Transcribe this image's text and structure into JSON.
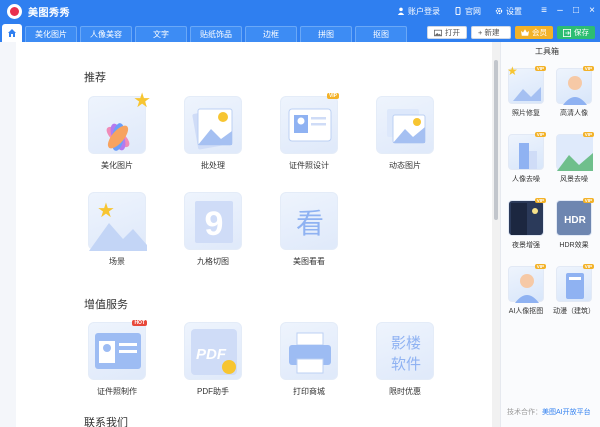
{
  "app": {
    "title": "美图秀秀"
  },
  "titlebar": {
    "account_label": "账户登录",
    "website_label": "官网",
    "settings_label": "设置"
  },
  "nav": {
    "tabs": [
      "美化图片",
      "人像美容",
      "文字",
      "贴纸饰品",
      "边框",
      "拼图",
      "抠图"
    ],
    "open_label": "打开",
    "new_label": "+ 新建",
    "vip_label": "会员",
    "save_label": "保存"
  },
  "sections": {
    "recommend": "推荐",
    "value_added": "增值服务",
    "contact": "联系我们"
  },
  "recommend_items": [
    {
      "label": "美化图片",
      "badge": ""
    },
    {
      "label": "批处理",
      "badge": ""
    },
    {
      "label": "证件照设计",
      "badge": "VIP"
    },
    {
      "label": "动态图片",
      "badge": ""
    },
    {
      "label": "场景",
      "badge": ""
    },
    {
      "label": "九格切图",
      "badge": ""
    },
    {
      "label": "美图看看",
      "badge": ""
    }
  ],
  "value_items": [
    {
      "label": "证件照制作",
      "badge": "HOT"
    },
    {
      "label": "PDF助手",
      "badge": ""
    },
    {
      "label": "打印商城",
      "badge": ""
    },
    {
      "label": "限时优惠",
      "badge": ""
    }
  ],
  "thumb_text": {
    "nine": "9",
    "kan": "看",
    "pdf": "PDF",
    "shadow_top": "影楼",
    "shadow_bottom": "软件",
    "hdr": "HDR"
  },
  "toolbox": {
    "title": "工具箱",
    "items": [
      {
        "label": "照片修复",
        "badge": "VIP"
      },
      {
        "label": "高清人像",
        "badge": "VIP"
      },
      {
        "label": "人像去噪",
        "badge": "VIP"
      },
      {
        "label": "风景去噪",
        "badge": "VIP"
      },
      {
        "label": "夜景增强",
        "badge": "VIP"
      },
      {
        "label": "HDR效果",
        "badge": "VIP"
      },
      {
        "label": "AI人像抠图",
        "badge": "VIP"
      },
      {
        "label": "动漫（建筑）",
        "badge": "VIP"
      }
    ],
    "coop_prefix": "技术合作：",
    "coop_link": "美图AI开放平台"
  },
  "colors": {
    "brand": "#2f7ff0",
    "vip": "#f3b228",
    "save": "#2dbd72",
    "hot": "#e8493b"
  }
}
